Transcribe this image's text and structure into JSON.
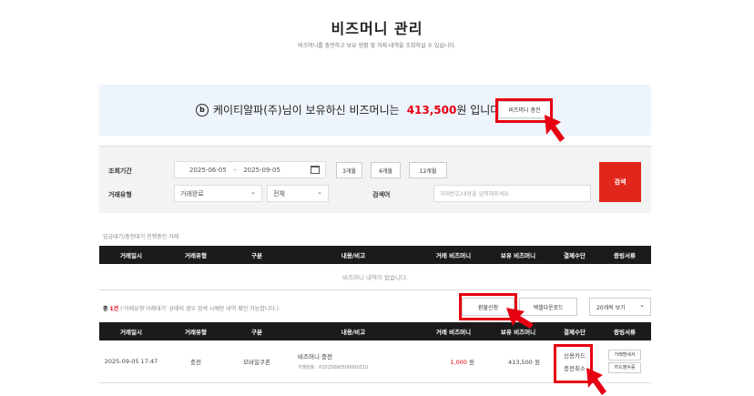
{
  "header": {
    "title": "비즈머니 관리",
    "description": "비즈머니를 충전하고 보유 현황 및 거래 내역을 조회하실 수 있습니다."
  },
  "balance": {
    "coin_symbol": "b",
    "text_prefix": "케이티알파(주)님이 보유하신 비즈머니는",
    "amount": "413,500",
    "text_suffix": "원 입니다.",
    "charge_button": "비즈머니 충전"
  },
  "search": {
    "period_label": "조회기간",
    "start_date": "2025-06-05",
    "date_separator": "-",
    "end_date": "2025-09-05",
    "period_buttons": [
      "3개월",
      "6개월",
      "12개월"
    ],
    "type_label": "거래유형",
    "type_select": "거래완료",
    "category_select": "전체",
    "keyword_label": "검색어",
    "keyword_placeholder": "거래번호/내용을 입력해주세요.",
    "search_button": "검색"
  },
  "pending_section": {
    "note": "입금대기/충전대기 진행중인 거래",
    "columns": [
      "거래일시",
      "거래유형",
      "구분",
      "내용/비고",
      "거래 비즈머니",
      "보유 비즈머니",
      "결제수단",
      "증빙서류"
    ],
    "empty_text": "비즈머니 내역이 없습니다."
  },
  "history_section": {
    "count_prefix": "총",
    "count": "1건",
    "count_note": "('거래유형'거래대기' 상태의 경우 검색 시에만 내역 확인 가능합니다.)",
    "refund_button": "환불신청",
    "excel_button": "엑셀다운로드",
    "page_size_select": "20개씩 보기",
    "columns": [
      "거래일시",
      "거래유형",
      "구분",
      "내용/비고",
      "거래 비즈머니",
      "보유 비즈머니",
      "결제수단",
      "증빙서류"
    ],
    "rows": [
      {
        "datetime": "2025-09-05 17:47",
        "type": "충전",
        "category": "모바일쿠폰",
        "content_title": "비즈머니 충전",
        "content_sub": "거래번호 : P2025090500000310",
        "trade_amount": "1,000",
        "trade_unit": "원",
        "balance_amount": "413,500",
        "balance_unit": "원",
        "payment_method": "신용카드",
        "payment_action": "충전취소",
        "proof_buttons": [
          "거래명세서",
          "카드영수증"
        ]
      }
    ]
  },
  "colors": {
    "accent_red": "#e60012",
    "search_button": "#e1261c",
    "table_header": "#1b1b1b",
    "balance_bg": "#eef4fb"
  }
}
